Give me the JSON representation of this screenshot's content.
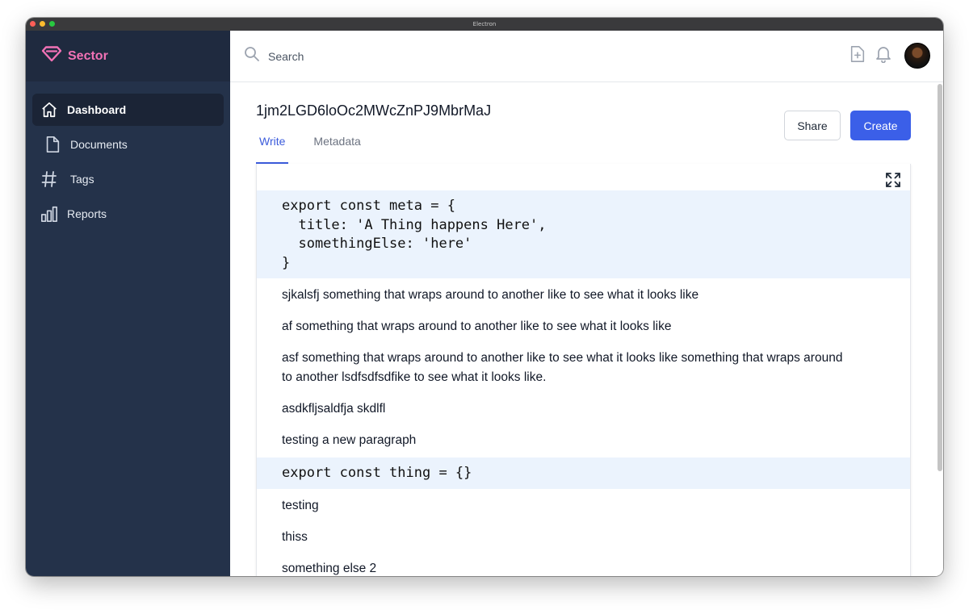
{
  "window": {
    "title": "Electron"
  },
  "brand": {
    "name": "Sector",
    "color": "#f272b6"
  },
  "sidebar": {
    "items": [
      {
        "label": "Dashboard",
        "icon": "home-icon",
        "active": true
      },
      {
        "label": "Documents",
        "icon": "document-icon",
        "active": false
      },
      {
        "label": "Tags",
        "icon": "hash-icon",
        "active": false
      },
      {
        "label": "Reports",
        "icon": "bar-chart-icon",
        "active": false
      }
    ]
  },
  "search": {
    "placeholder": "Search"
  },
  "document": {
    "title": "1jm2LGD6loOc2MWcZnPJ9MbrMaJ",
    "tabs": [
      {
        "label": "Write",
        "active": true
      },
      {
        "label": "Metadata",
        "active": false
      }
    ],
    "share_label": "Share",
    "create_label": "Create"
  },
  "editor": {
    "code1": "export const meta = {\n  title: 'A Thing happens Here',\n  somethingElse: 'here'\n}",
    "para1": "sjkalsfj something that wraps around to another like to see what it looks like",
    "para2": "af something that wraps around to another like to see what it looks like",
    "para3": "asf something that wraps around to another like to see what it looks like something that wraps around to another lsdfsdfsdfike to see what it looks like.",
    "para4": "asdkfljsaldfja skdlfl",
    "para5": "testing a new paragraph",
    "code2": "export const thing = {}",
    "para6": "testing",
    "para7": "thiss",
    "para8": "something else 2"
  },
  "colors": {
    "accent": "#3b5fe8",
    "sidebar": "#24324a",
    "code_bg": "#ebf3fd"
  }
}
